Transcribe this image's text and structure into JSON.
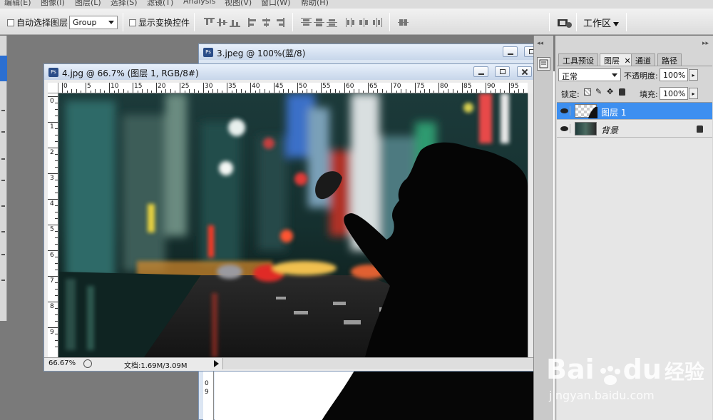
{
  "menu": [
    "编辑(E)",
    "图像(I)",
    "图层(L)",
    "选择(S)",
    "滤镜(T)",
    "Analysis",
    "视图(V)",
    "窗口(W)",
    "帮助(H)"
  ],
  "options": {
    "auto_select_label": "自动选择图层",
    "auto_select_value": "Group",
    "show_transform_label": "显示变换控件",
    "workspace_label": "工作区"
  },
  "back_doc": {
    "title": "3.jpeg @ 100%(蓝/8)"
  },
  "front_doc": {
    "title": "4.jpg @ 66.7% (图层 1, RGB/8#)",
    "zoom": "66.67%",
    "doc_size": "文档:1.69M/3.09M",
    "ruler_h": [
      "0",
      "5",
      "10",
      "15",
      "20",
      "25",
      "30",
      "35",
      "40",
      "45",
      "50",
      "55",
      "60",
      "65",
      "70",
      "75",
      "80",
      "85",
      "90",
      "95"
    ],
    "ruler_v": [
      "0",
      "1",
      "2",
      "3",
      "4",
      "5",
      "6",
      "7",
      "8",
      "9"
    ]
  },
  "back_ruler_v": [
    "0",
    "9"
  ],
  "layers_panel": {
    "tabs": [
      "工具预设",
      "图层",
      "通道",
      "路径"
    ],
    "blend_mode": "正常",
    "opacity_label": "不透明度:",
    "opacity": "100%",
    "lock_label": "锁定:",
    "fill_label": "填充:",
    "fill": "100%",
    "layers": [
      {
        "name": "图层 1",
        "selected": true
      },
      {
        "name": "背景",
        "selected": false,
        "locked": true
      }
    ]
  },
  "watermark": {
    "brand": "Bai",
    "brand2": "du",
    "cn": "经验",
    "url": "jingyan.baidu.com"
  },
  "colors": {
    "selection": "#3d8ff0",
    "title_bar": "#c7d6ea",
    "workspace_bg": "#7a7a7a"
  }
}
